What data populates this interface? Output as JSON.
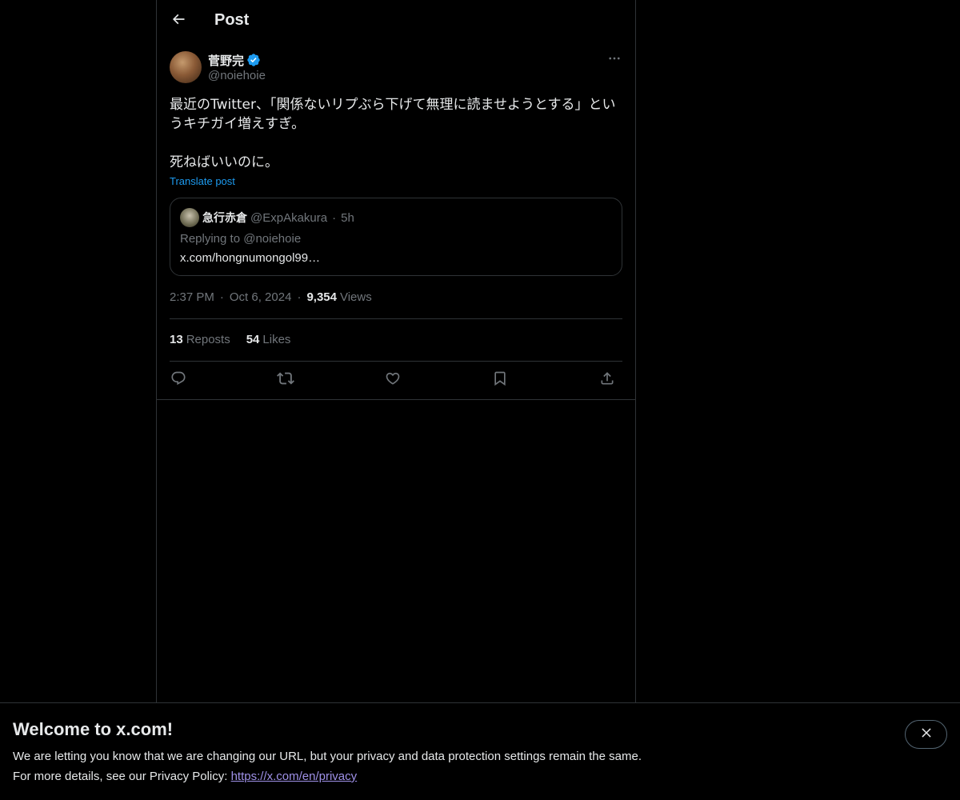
{
  "header": {
    "title": "Post",
    "back_icon": "arrow-left-icon"
  },
  "post": {
    "author": {
      "name": "菅野完",
      "handle": "@noiehoie",
      "verified": true,
      "verified_color": "#1d9bf0"
    },
    "text": "最近のTwitter、「関係ないリプぶら下げて無理に読ませようとする」というキチガイ増えすぎ。\n\n死ねばいいのに。",
    "translate_label": "Translate post",
    "quote": {
      "name": "急行赤倉",
      "handle": "@ExpAkakura",
      "separator": "·",
      "time": "5h",
      "replying_to": "Replying to @noiehoie",
      "link_text": "x.com/hongnumongol99…"
    },
    "meta": {
      "time": "2:37 PM",
      "date": "Oct 6, 2024",
      "separator": "·",
      "views_count": "9,354",
      "views_label": "Views"
    },
    "stats": {
      "reposts_count": "13",
      "reposts_label": "Reposts",
      "likes_count": "54",
      "likes_label": "Likes"
    },
    "actions": [
      "reply-icon",
      "repost-icon",
      "like-icon",
      "bookmark-icon",
      "share-icon"
    ]
  },
  "banner": {
    "title": "Welcome to x.com!",
    "line1": "We are letting you know that we are changing our URL, but your privacy and data protection settings remain the same.",
    "line2_prefix": "For more details, see our Privacy Policy: ",
    "link": "https://x.com/en/privacy",
    "close_icon": "close-icon"
  },
  "colors": {
    "background": "#000000",
    "text_primary": "#e7e9ea",
    "text_secondary": "#71767b",
    "border": "#2f3336",
    "accent": "#1d9bf0",
    "link_visited": "#9f91e8"
  }
}
